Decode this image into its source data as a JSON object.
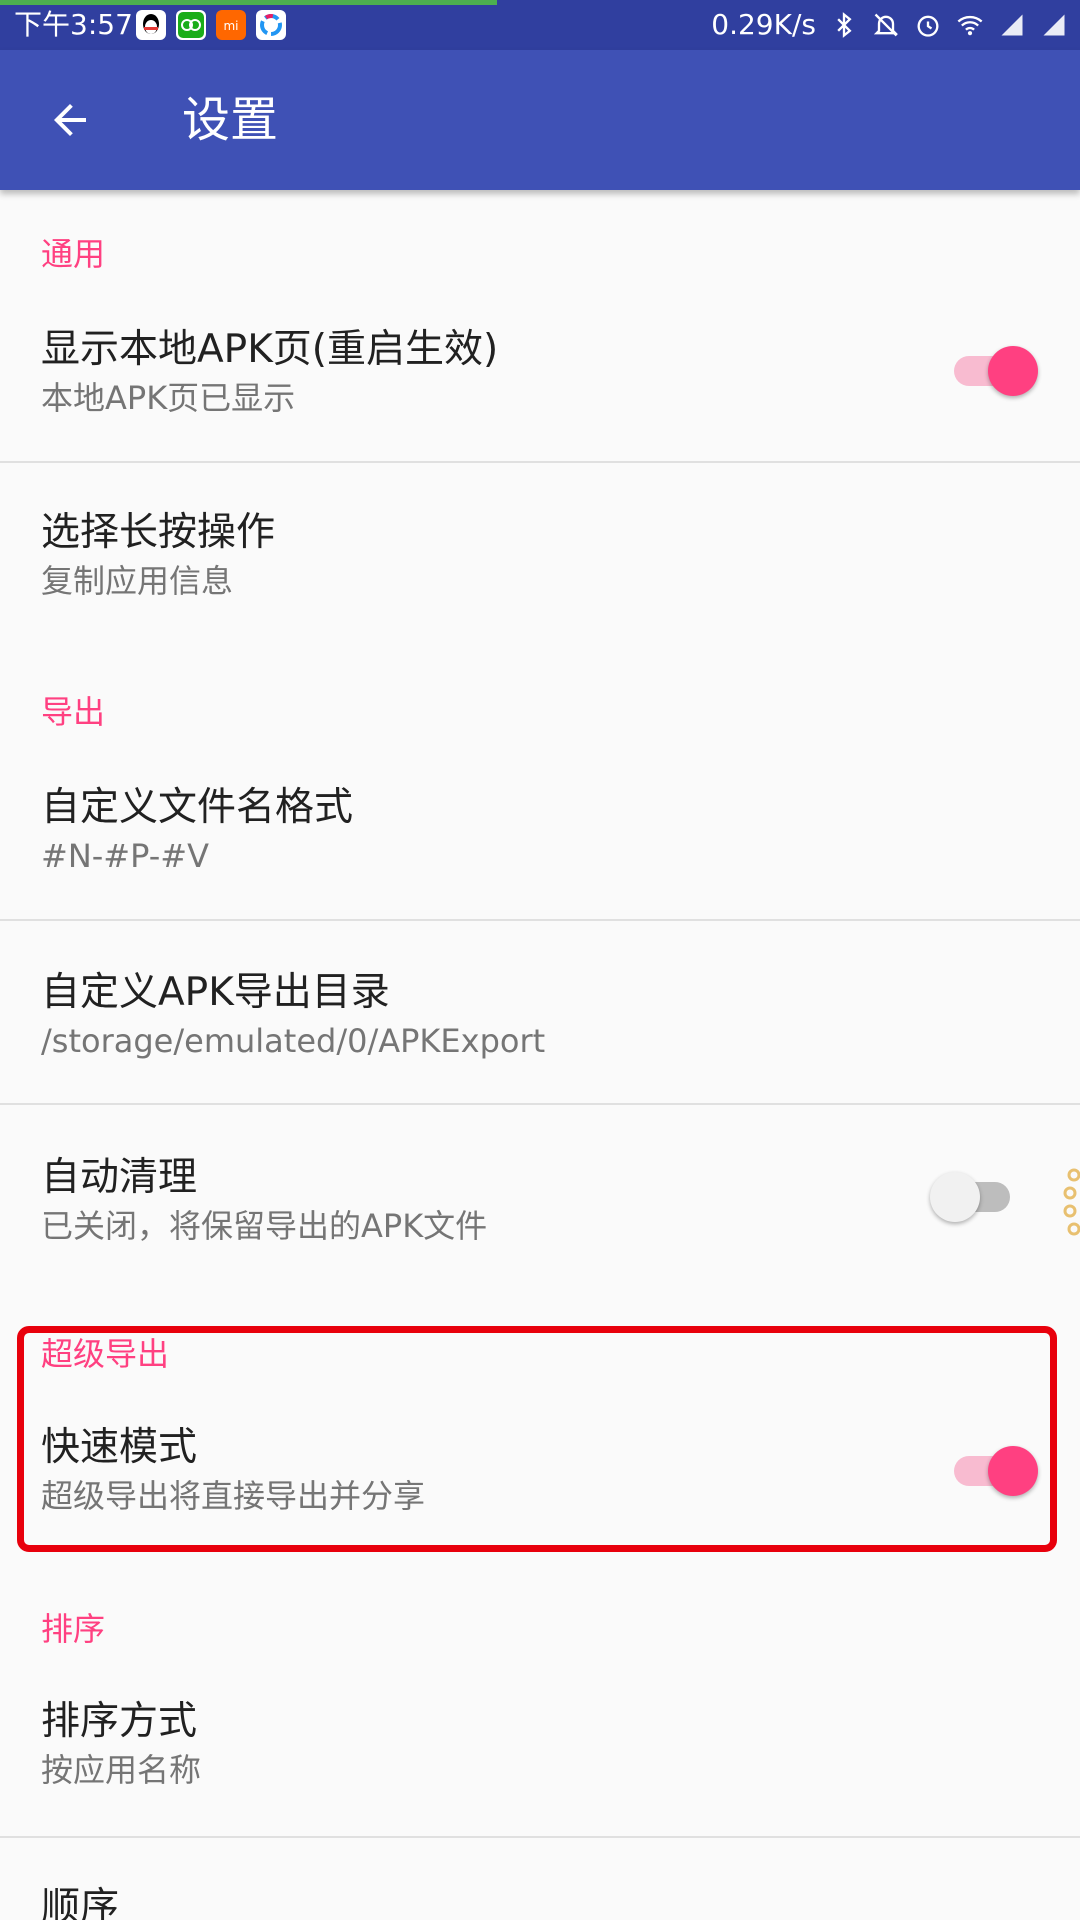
{
  "status_bar": {
    "time": "下午3:57",
    "net_speed": "0.29K/s",
    "progress_fraction": 0.46,
    "app_icons": [
      "qq-icon",
      "wechat-icon",
      "mi-icon",
      "colorful-app-icon"
    ],
    "system_icons": [
      "bluetooth-icon",
      "notifications-off-icon",
      "alarm-icon",
      "wifi-icon",
      "signal-icon",
      "signal-icon"
    ]
  },
  "app_bar": {
    "title": "设置"
  },
  "sections": {
    "general": "通用",
    "export": "导出",
    "super_export": "超级导出",
    "sort": "排序"
  },
  "prefs": {
    "show_local_apk": {
      "title": "显示本地APK页(重启生效)",
      "summary": "本地APK页已显示",
      "switch_on": true
    },
    "long_press": {
      "title": "选择长按操作",
      "summary": "复制应用信息"
    },
    "file_name_format": {
      "title": "自定义文件名格式",
      "summary": "#N-#P-#V"
    },
    "export_dir": {
      "title": "自定义APK导出目录",
      "summary": "/storage/emulated/0/APKExport"
    },
    "auto_clean": {
      "title": "自动清理",
      "summary": "已关闭，将保留导出的APK文件",
      "switch_on": false
    },
    "fast_mode": {
      "title": "快速模式",
      "summary": "超级导出将直接导出并分享",
      "switch_on": true
    },
    "sort_mode": {
      "title": "排序方式",
      "summary": "按应用名称"
    },
    "order": {
      "title": "顺序"
    }
  },
  "colors": {
    "status_bar": "#303f9f",
    "app_bar": "#3f51b5",
    "accent": "#ff4081",
    "highlight": "#e8000c"
  }
}
